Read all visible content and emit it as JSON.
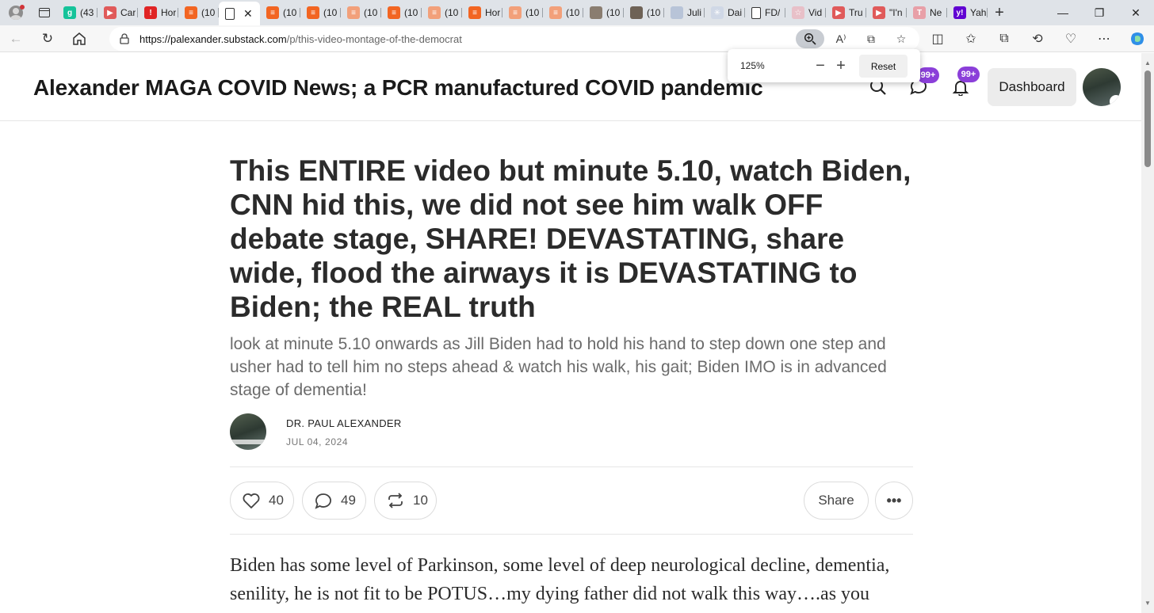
{
  "browser": {
    "tabs": [
      {
        "label": "(43",
        "icon": "grammarly-icon",
        "color": "#15c39a",
        "glyph": "g"
      },
      {
        "label": "Car",
        "icon": "youtube-icon",
        "color": "#e05a5a",
        "glyph": "▶"
      },
      {
        "label": "Hor",
        "icon": "red-app-icon",
        "color": "#e02424",
        "glyph": "!"
      },
      {
        "label": "(10",
        "icon": "substack-icon",
        "color": "#f26522",
        "glyph": "≡"
      },
      {
        "label": "",
        "icon": "page-icon",
        "color": "#ffffff",
        "glyph": "",
        "active": true
      },
      {
        "label": "(10",
        "icon": "substack-icon",
        "color": "#f26522",
        "glyph": "≡"
      },
      {
        "label": "(10",
        "icon": "substack-icon",
        "color": "#f26522",
        "glyph": "≡"
      },
      {
        "label": "(10",
        "icon": "substack-icon",
        "color": "#f2a07a",
        "glyph": "≡"
      },
      {
        "label": "(10",
        "icon": "substack-icon",
        "color": "#f26522",
        "glyph": "≡"
      },
      {
        "label": "(10",
        "icon": "substack-icon",
        "color": "#f2a07a",
        "glyph": "≡"
      },
      {
        "label": "Hor",
        "icon": "substack-icon",
        "color": "#f26522",
        "glyph": "≡"
      },
      {
        "label": "(10",
        "icon": "substack-icon",
        "color": "#f2a07a",
        "glyph": "≡"
      },
      {
        "label": "(10",
        "icon": "substack-icon",
        "color": "#f2a07a",
        "glyph": "≡"
      },
      {
        "label": "(10",
        "icon": "photo-icon",
        "color": "#8a7d70",
        "glyph": ""
      },
      {
        "label": "(10",
        "icon": "photo-icon",
        "color": "#6e6256",
        "glyph": ""
      },
      {
        "label": "Juli",
        "icon": "globe-icon",
        "color": "#b8c4d8",
        "glyph": ""
      },
      {
        "label": "Dai",
        "icon": "globe-icon",
        "color": "#d0d8e6",
        "glyph": "✳"
      },
      {
        "label": "FD/",
        "icon": "page-icon",
        "color": "#ffffff",
        "glyph": ""
      },
      {
        "label": "Vid",
        "icon": "star-icon",
        "color": "#e8c0c8",
        "glyph": "☆"
      },
      {
        "label": "Tru",
        "icon": "youtube-icon",
        "color": "#e05a5a",
        "glyph": "▶"
      },
      {
        "label": "\"I'n",
        "icon": "youtube-icon",
        "color": "#e05a5a",
        "glyph": "▶"
      },
      {
        "label": "Ne",
        "icon": "news-icon",
        "color": "#e8a0a8",
        "glyph": "T"
      },
      {
        "label": "Yah",
        "icon": "yahoo-icon",
        "color": "#6001d2",
        "glyph": "y!"
      }
    ],
    "url_domain": "https://palexander.substack.com",
    "url_path": "/p/this-video-montage-of-the-democrat",
    "zoom_level": "125%",
    "zoom_reset_label": "Reset"
  },
  "header": {
    "pub_title": "Alexander MAGA COVID News; a PCR manufactured COVID pandemic",
    "chat_badge": "99+",
    "notif_badge": "99+",
    "dashboard_label": "Dashboard"
  },
  "article": {
    "title": "This ENTIRE video but minute 5.10, watch Biden, CNN hid this, we did not see him walk OFF debate stage, SHARE! DEVASTATING, share wide, flood the airways it is DEVASTATING to Biden; the REAL truth",
    "subtitle": "look at minute 5.10 onwards as Jill Biden had to hold his hand to step down one step and usher had to tell him no steps ahead & watch his walk, his gait; Biden IMO is in advanced stage of dementia!",
    "author": "DR. PAUL ALEXANDER",
    "date": "JUL 04, 2024",
    "likes": "40",
    "comments": "49",
    "restacks": "10",
    "share_label": "Share",
    "body": "Biden has some level of Parkinson, some level of deep neurological decline, dementia, senility, he is not fit to be POTUS…my dying father did not walk this way….as you"
  },
  "colors": {
    "badge": "#8b3fd9",
    "tabstrip": "#dfe3e8",
    "title_text": "#2b2b2b"
  }
}
